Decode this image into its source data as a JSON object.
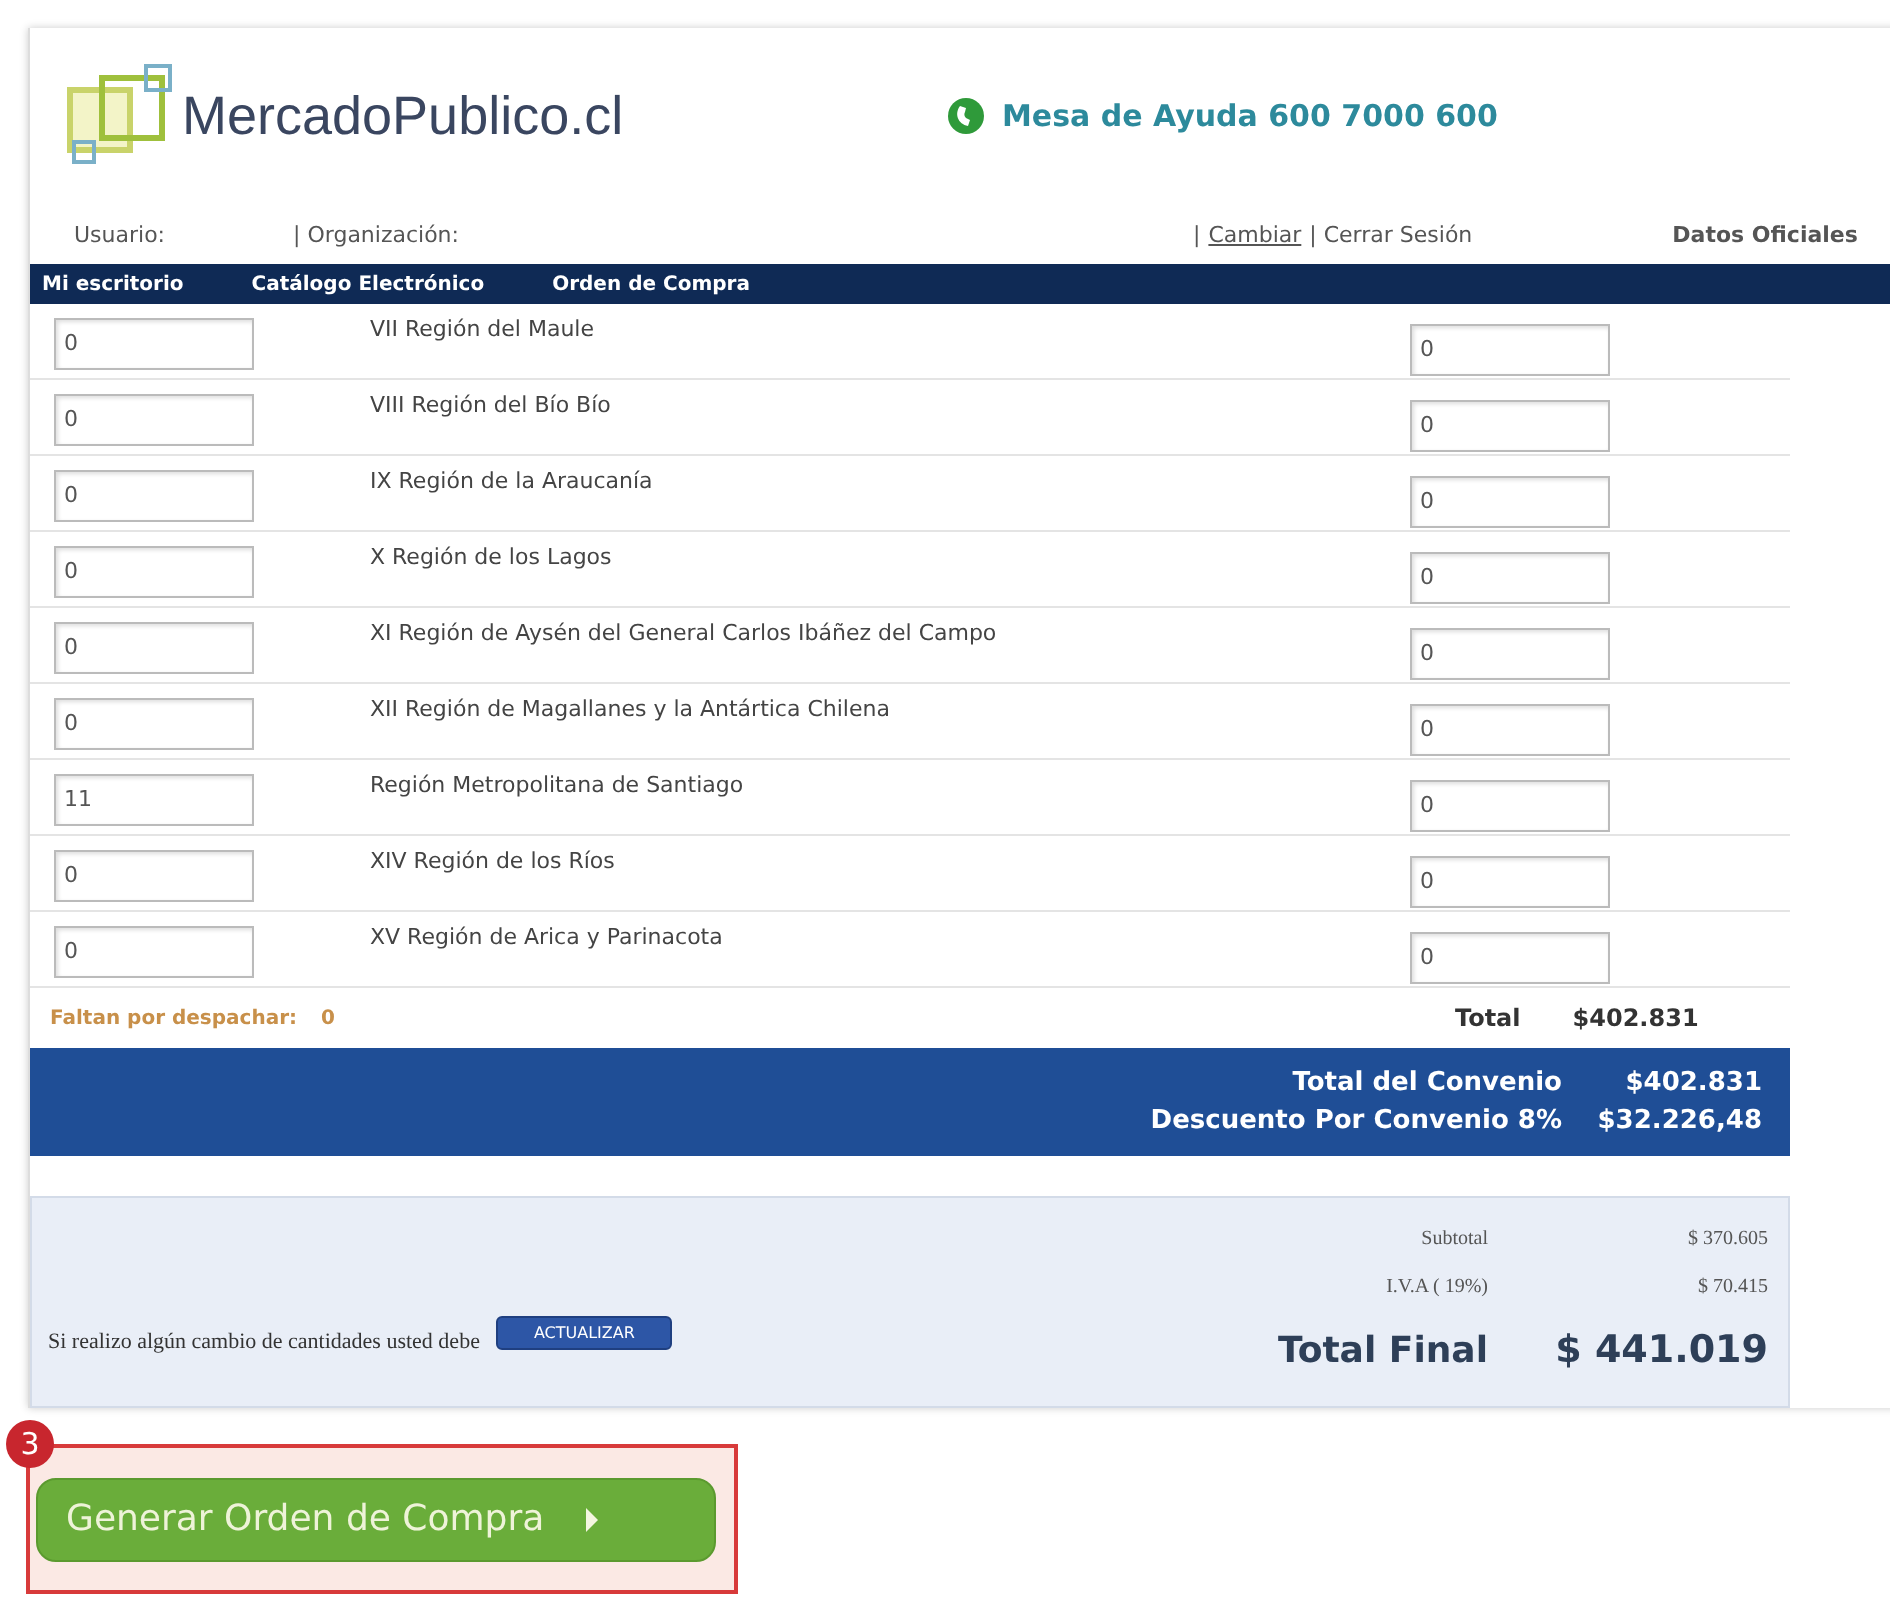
{
  "header": {
    "logo": "MercadoPublico.cl",
    "helpdesk": "Mesa de Ayuda 600 7000 600"
  },
  "user_bar": {
    "usuario": "Usuario:",
    "organizacion": "| Organización:",
    "sep": "|",
    "cambiar": "Cambiar",
    "cerrar": "| Cerrar Sesión",
    "datos": "Datos Oficiales"
  },
  "nav": [
    "Mi escritorio",
    "Catálogo Electrónico",
    "Orden de Compra"
  ],
  "rows": [
    {
      "qty": "0",
      "region": "VII Región del Maule",
      "value": "0"
    },
    {
      "qty": "0",
      "region": "VIII Región del Bío Bío",
      "value": "0"
    },
    {
      "qty": "0",
      "region": "IX Región de la Araucanía",
      "value": "0"
    },
    {
      "qty": "0",
      "region": "X Región de los Lagos",
      "value": "0"
    },
    {
      "qty": "0",
      "region": "XI Región de Aysén del General Carlos Ibáñez del Campo",
      "value": "0"
    },
    {
      "qty": "0",
      "region": "XII Región de Magallanes y la Antártica Chilena",
      "value": "0"
    },
    {
      "qty": "11",
      "region": "Región Metropolitana de Santiago",
      "value": "0"
    },
    {
      "qty": "0",
      "region": "XIV Región de los Ríos",
      "value": "0"
    },
    {
      "qty": "0",
      "region": "XV Región de Arica y Parinacota",
      "value": "0"
    }
  ],
  "pending": {
    "label": "Faltan por despachar:",
    "value": "0"
  },
  "total": {
    "label": "Total",
    "value": "$402.831"
  },
  "convenio": [
    {
      "label": "Total del Convenio",
      "value": "$402.831"
    },
    {
      "label": "Descuento Por Convenio 8%",
      "value": "$32.226,48"
    }
  ],
  "summary": {
    "note": "Si realizo algún cambio de cantidades usted debe",
    "update_button": "ACTUALIZAR",
    "lines": [
      {
        "label": "Subtotal",
        "value": "$ 370.605"
      },
      {
        "label": "I.V.A ( 19%)",
        "value": "$ 70.415"
      }
    ],
    "final": {
      "label": "Total Final",
      "value": "$ 441.019"
    }
  },
  "generate_button": "Generar Orden de Compra",
  "callout": "3"
}
